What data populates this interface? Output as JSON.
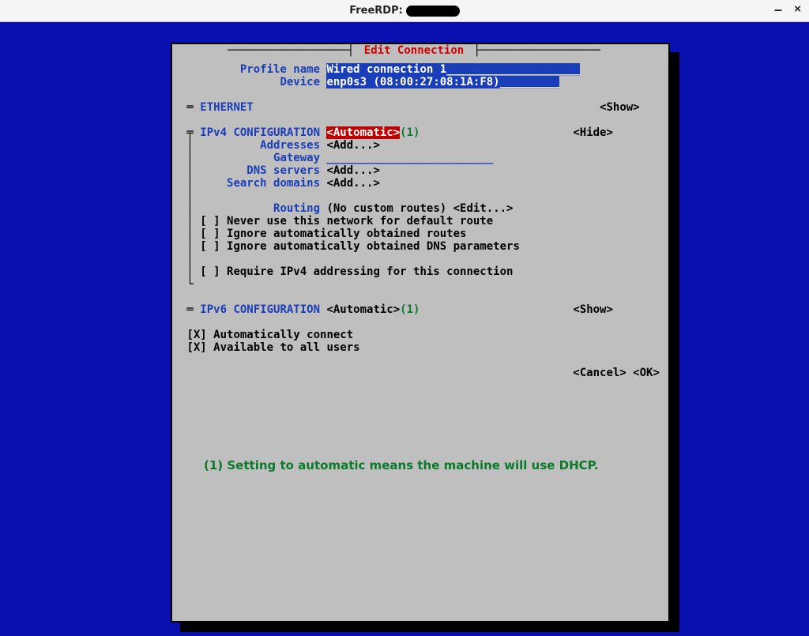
{
  "window": {
    "title_prefix": "FreeRDP: "
  },
  "panel": {
    "title": "Edit Connection",
    "profile_label": "Profile name",
    "profile_value": "Wired connection 1",
    "device_label": "Device",
    "device_value": "enp0s3 (08:00:27:08:1A:F8)",
    "ethernet_label": "ETHERNET",
    "show": "<Show>",
    "hide": "<Hide>",
    "ipv4_label": "IPv4 CONFIGURATION",
    "ipv4_mode": "<Automatic>",
    "ipv6_label": "IPv6 CONFIGURATION",
    "ipv6_mode": "<Automatic>",
    "addresses_label": "Addresses",
    "gateway_label": "Gateway",
    "dns_label": "DNS servers",
    "search_label": "Search domains",
    "routing_label": "Routing",
    "routing_value": "(No custom routes)",
    "edit": "<Edit...>",
    "add": "<Add...>",
    "chk_never_default": "[ ] Never use this network for default route",
    "chk_ignore_routes": "[ ] Ignore automatically obtained routes",
    "chk_ignore_dns": "[ ] Ignore automatically obtained DNS parameters",
    "chk_require_ipv4": "[ ] Require IPv4 addressing for this connection",
    "chk_autoconnect": "[X] Automatically connect",
    "chk_allusers": "[X] Available to all users",
    "note_marker": "(1)",
    "cancel": "<Cancel>",
    "ok": "<OK>",
    "footnote": "(1) Setting to automatic means the machine will use DHCP."
  }
}
